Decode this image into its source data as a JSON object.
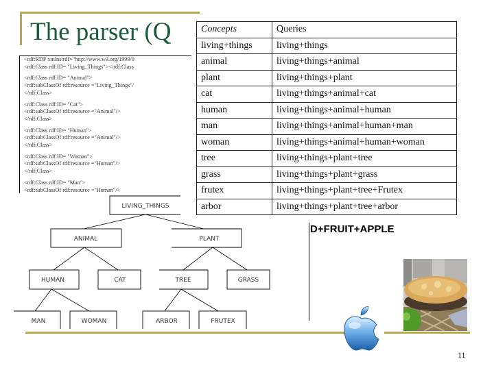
{
  "slide": {
    "title": "The parser (Q",
    "page_number": "11",
    "colors": {
      "title": "#1e5a3c",
      "accent_rule": "#b8a94c"
    }
  },
  "rdf_code": {
    "lines": [
      "<rdf:RDF xmlns:rdf=\"http://www.w3.org/1999/0",
      "<rdf:Class rdf:ID= \"Living_Things\"></rdf:Class",
      "",
      "<rdf:Class rdf:ID= \"Animal\">",
      "<rdf:subClassOf rdf:resource =\"Living_Things\"/",
      "</rdf:Class>",
      "",
      "<rdf:Class rdf:ID= \"Cat\">",
      "<rdf:subClassOf rdf:resource =\"Animal\"/>",
      "</rdf:Class>",
      "",
      "<rdf:Class rdf:ID= \"Human\">",
      "<rdf:subClassOf rdf:resource =\"Animal\"/>",
      "</rdf:Class>",
      "",
      "<rdf:Class rdf:ID= \"Woman\">",
      "<rdf:subClassOf rdf:resource =\"Human\"/>",
      "</rdf:Class>",
      "",
      "<rdf:Class rdf:ID= \"Man\">",
      "<rdf:subClassOf rdf:resource =\"Human\"/>",
      "</rdf:Class>"
    ]
  },
  "table": {
    "headers": [
      "Concepts",
      "Queries"
    ],
    "rows": [
      [
        "living+things",
        "living+things"
      ],
      [
        "animal",
        "living+things+animal"
      ],
      [
        "plant",
        "living+things+plant"
      ],
      [
        "cat",
        "living+things+animal+cat"
      ],
      [
        "human",
        "living+things+animal+human"
      ],
      [
        "man",
        "living+things+animal+human+man"
      ],
      [
        "woman",
        "living+things+animal+human+woman"
      ],
      [
        "tree",
        "living+things+plant+tree"
      ],
      [
        "grass",
        "living+things+plant+grass"
      ],
      [
        "frutex",
        "living+things+plant+tree+Frutex"
      ],
      [
        "arbor",
        "living+things+plant+tree+arbor"
      ]
    ]
  },
  "tree": {
    "nodes": {
      "living_things": "LIVING_THINGS",
      "animal": "ANIMAL",
      "plant": "PLANT",
      "human": "HUMAN",
      "cat": "CAT",
      "tree": "TREE",
      "grass": "GRASS",
      "man": "MAN",
      "woman": "WOMAN",
      "arbor": "ARBOR",
      "frutex": "FRUTEX"
    }
  },
  "fruit_example": {
    "label": "D+FRUIT+APPLE",
    "images": [
      "apple-pie-photo",
      "apple-logo"
    ]
  }
}
